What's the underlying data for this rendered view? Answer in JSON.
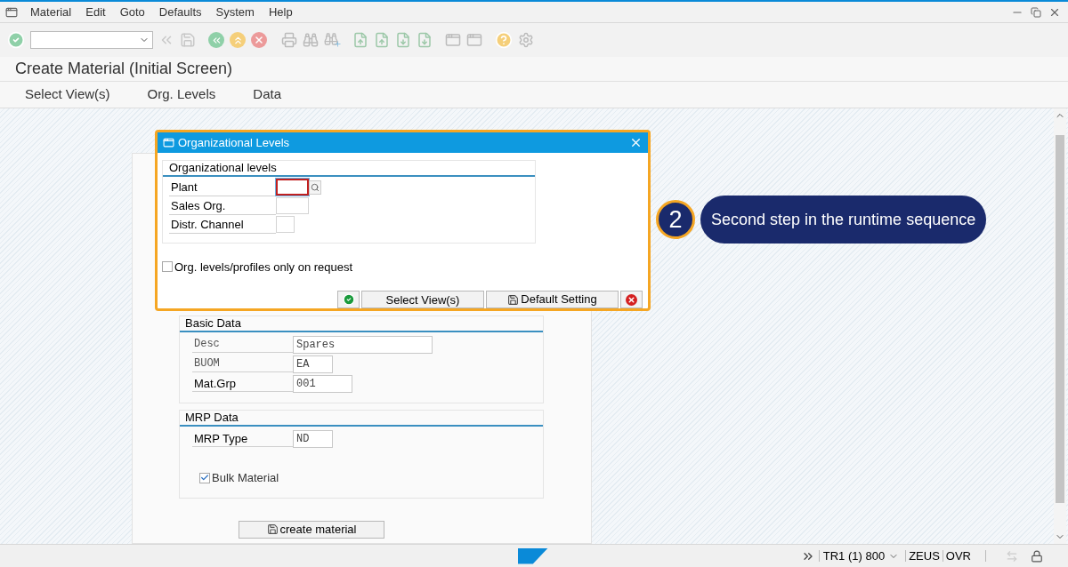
{
  "menu": [
    "Material",
    "Edit",
    "Goto",
    "Defaults",
    "System",
    "Help"
  ],
  "window_title": "Create Material (Initial Screen)",
  "app_toolbar": [
    "Select View(s)",
    "Org. Levels",
    "Data"
  ],
  "basic_data": {
    "title": "Basic Data",
    "fields": [
      {
        "label": "Desc",
        "value": "Spares",
        "kind": "mono"
      },
      {
        "label": "BUOM",
        "value": "EA",
        "kind": "mono"
      },
      {
        "label": "Mat.Grp",
        "value": "001",
        "kind": "plain"
      }
    ]
  },
  "mrp_data": {
    "title": "MRP Data",
    "fields": [
      {
        "label": "MRP Type",
        "value": "ND",
        "kind": "plain"
      }
    ],
    "checkbox": {
      "label": "Bulk Material",
      "checked": true
    }
  },
  "create_button": "create material",
  "dialog": {
    "title": "Organizational Levels",
    "group_title": "Organizational levels",
    "fields": [
      {
        "label": "Plant",
        "focused": true
      },
      {
        "label": "Sales Org.",
        "focused": false
      },
      {
        "label": "Distr. Channel",
        "focused": false
      }
    ],
    "checkbox": {
      "label": "Org. levels/profiles only on request",
      "checked": false
    },
    "buttons": [
      {
        "kind": "confirm"
      },
      {
        "kind": "text",
        "label": "Select View(s)"
      },
      {
        "kind": "save",
        "label": "Default Setting"
      },
      {
        "kind": "cancel"
      }
    ]
  },
  "callout": {
    "number": "2",
    "text": "Second step in the runtime sequence"
  },
  "status_bar": {
    "system": "TR1 (1) 800",
    "user": "ZEUS",
    "mode": "OVR"
  }
}
